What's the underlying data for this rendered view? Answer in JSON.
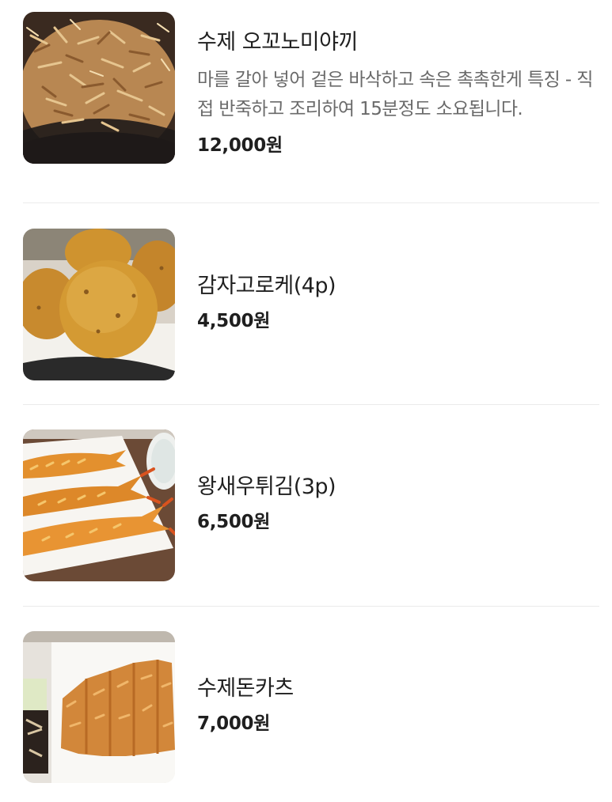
{
  "menu": {
    "items": [
      {
        "name": "수제 오꼬노미야끼",
        "description": "마를 갈아 넣어 겉은 바삭하고 속은 촉촉한게 특징 - 직접 반죽하고 조리하여 15분정도 소요됩니다.",
        "price": "12,000원",
        "image_icon": "okonomiyaki-photo"
      },
      {
        "name": "감자고로케(4p)",
        "price": "4,500원",
        "image_icon": "potato-croquette-photo"
      },
      {
        "name": "왕새우튀김(3p)",
        "price": "6,500원",
        "image_icon": "fried-shrimp-photo"
      },
      {
        "name": "수제돈카츠",
        "price": "7,000원",
        "image_icon": "pork-cutlet-photo"
      }
    ]
  }
}
